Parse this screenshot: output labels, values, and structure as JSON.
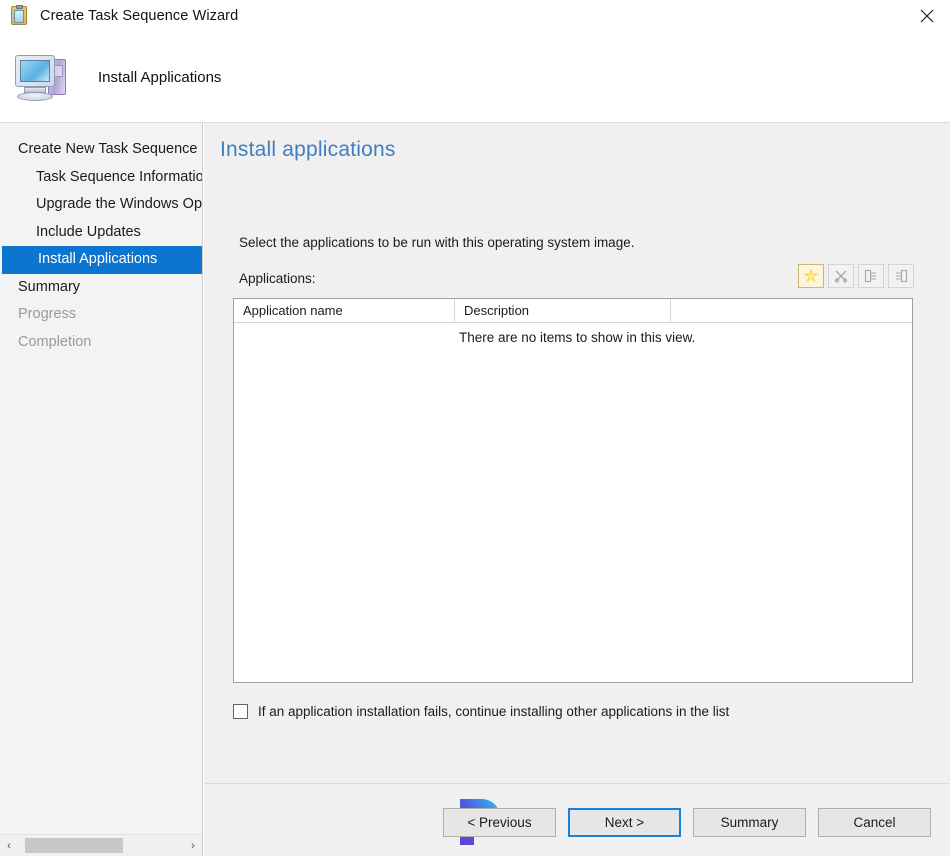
{
  "window": {
    "title": "Create Task Sequence Wizard",
    "title_icon": "clipboard-icon",
    "close_label": "✕"
  },
  "wizard_header": {
    "icon": "computer-icon",
    "text": "Install Applications"
  },
  "sidebar": {
    "items": [
      {
        "label": "Create New Task Sequence",
        "indent": false,
        "state": "normal"
      },
      {
        "label": "Task Sequence Information",
        "indent": true,
        "state": "normal"
      },
      {
        "label": "Upgrade the Windows Operating System",
        "indent": true,
        "state": "normal"
      },
      {
        "label": "Include Updates",
        "indent": true,
        "state": "normal"
      },
      {
        "label": "Install Applications",
        "indent": true,
        "state": "selected"
      },
      {
        "label": "Summary",
        "indent": false,
        "state": "normal"
      },
      {
        "label": "Progress",
        "indent": false,
        "state": "disabled"
      },
      {
        "label": "Completion",
        "indent": false,
        "state": "disabled"
      }
    ],
    "scrollbar": {
      "left_arrow": "‹",
      "right_arrow": "›"
    }
  },
  "main": {
    "page_title": "Install applications",
    "instruction": "Select the applications to be run with this operating system image.",
    "applications_label": "Applications:",
    "toolbar": [
      {
        "name": "new-application-button",
        "icon": "star-icon",
        "enabled": true
      },
      {
        "name": "delete-application-button",
        "icon": "x-scissors-icon",
        "enabled": false
      },
      {
        "name": "move-up-button",
        "icon": "move-up-icon",
        "enabled": false
      },
      {
        "name": "move-down-button",
        "icon": "move-down-icon",
        "enabled": false
      }
    ],
    "listview": {
      "columns": [
        "Application name",
        "Description"
      ],
      "empty_message": "There are no items to show in this view.",
      "rows": []
    },
    "checkbox": {
      "checked": false,
      "label": "If an application installation fails, continue installing other applications in the list"
    }
  },
  "footer": {
    "buttons": [
      {
        "label": "< Previous",
        "default": false
      },
      {
        "label": "Next >",
        "default": true
      },
      {
        "label": "Summary",
        "default": false
      },
      {
        "label": "Cancel",
        "default": false
      }
    ]
  },
  "colors": {
    "accent_blue": "#0b75d0",
    "title_blue": "#3f7fbf",
    "sidebar_bg": "#f3f3f3",
    "content_bg": "#f0f0f0"
  }
}
